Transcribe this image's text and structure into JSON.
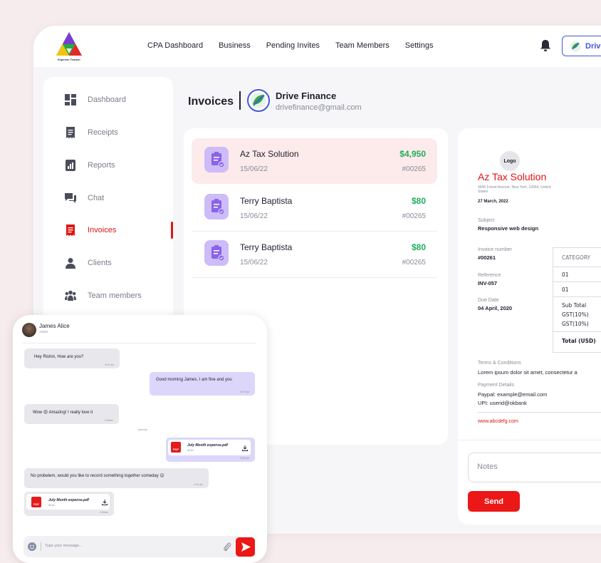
{
  "app": {
    "logo_tagline": "Expense Tracker"
  },
  "nav": [
    "CPA Dashboard",
    "Business",
    "Pending Invites",
    "Team Members",
    "Settings"
  ],
  "org_button": {
    "label": "Drive"
  },
  "sidebar": {
    "items": [
      {
        "label": "Dashboard",
        "icon": "dashboard-icon"
      },
      {
        "label": "Receipts",
        "icon": "receipt-icon"
      },
      {
        "label": "Reports",
        "icon": "reports-icon"
      },
      {
        "label": "Chat",
        "icon": "chat-icon"
      },
      {
        "label": "Invoices",
        "icon": "invoice-icon",
        "active": true
      },
      {
        "label": "Clients",
        "icon": "clients-icon"
      },
      {
        "label": "Team members",
        "icon": "team-icon"
      }
    ]
  },
  "invoices_header": {
    "title": "Invoices",
    "org_name": "Drive Finance",
    "org_email": "drivefinance@gmail.com"
  },
  "invoice_list": [
    {
      "name": "Az Tax Solution",
      "date": "15/06/22",
      "amount": "$4,950",
      "number": "#00265",
      "selected": true
    },
    {
      "name": "Terry Baptista",
      "date": "15/06/22",
      "amount": "$80",
      "number": "#00265"
    },
    {
      "name": "Terry Baptista",
      "date": "15/06/22",
      "amount": "$80",
      "number": "#00265"
    }
  ],
  "preview": {
    "logo_text": "Logo",
    "company": "Az Tax Solution",
    "address": "4945 Forest Avenue, New York, 10004, United States",
    "date": "27 March, 2022",
    "subject_label": "Subject",
    "subject": "Responsive web design",
    "invoice_number_label": "Invoice number",
    "invoice_number": "#00261",
    "reference_label": "Reference",
    "reference": "INV-057",
    "due_label": "Due Date",
    "due_date": "04 April, 2020",
    "table": {
      "header": "CATEGORY",
      "rows": [
        "01",
        "01"
      ],
      "sub_total": "Sub Total",
      "gst1": "GST(10%)",
      "gst2": "GST(10%)",
      "total": "Total (USD)"
    },
    "terms_label": "Terms & Conditions",
    "terms_text": "Lorem ipsum dolor sit amet, consectetur a",
    "payment_label": "Payment Details",
    "paypal": "Paypal: example@email.com",
    "upi": "UPI: userid@okbank",
    "website": "www.abcdefg.com",
    "notes_placeholder": "Notes",
    "send_label": "Send"
  },
  "chat": {
    "contact_name": "James Alice",
    "contact_status": "Active",
    "messages": [
      {
        "text": "Hey Rishin, How are you?",
        "time": "9:29 am"
      },
      {
        "text": "Good morning James, I am fine and you",
        "time": "9:37 am"
      },
      {
        "text": "Wow 😍 Amazing! I really love it",
        "time": "9:30am"
      },
      {
        "text": "No probelem, would you like to record something together someday 😉",
        "time": "9:34 am"
      }
    ],
    "just_now": "just now",
    "file_out": {
      "name": "July Month expense.pdf",
      "size": "56 kb",
      "time": "9:33 am"
    },
    "file_in": {
      "name": "July Month expense.pdf",
      "size": "56 kb",
      "time": "9:30am"
    },
    "pdf_label": "PDF",
    "input_placeholder": "Type your message..."
  },
  "colors": {
    "accent": "#e01414",
    "brand_blue": "#4457d6",
    "amount_green": "#1fae5b",
    "invoice_icon_bg": "#cdbcf7",
    "selected_row_bg": "#fdeaea"
  }
}
